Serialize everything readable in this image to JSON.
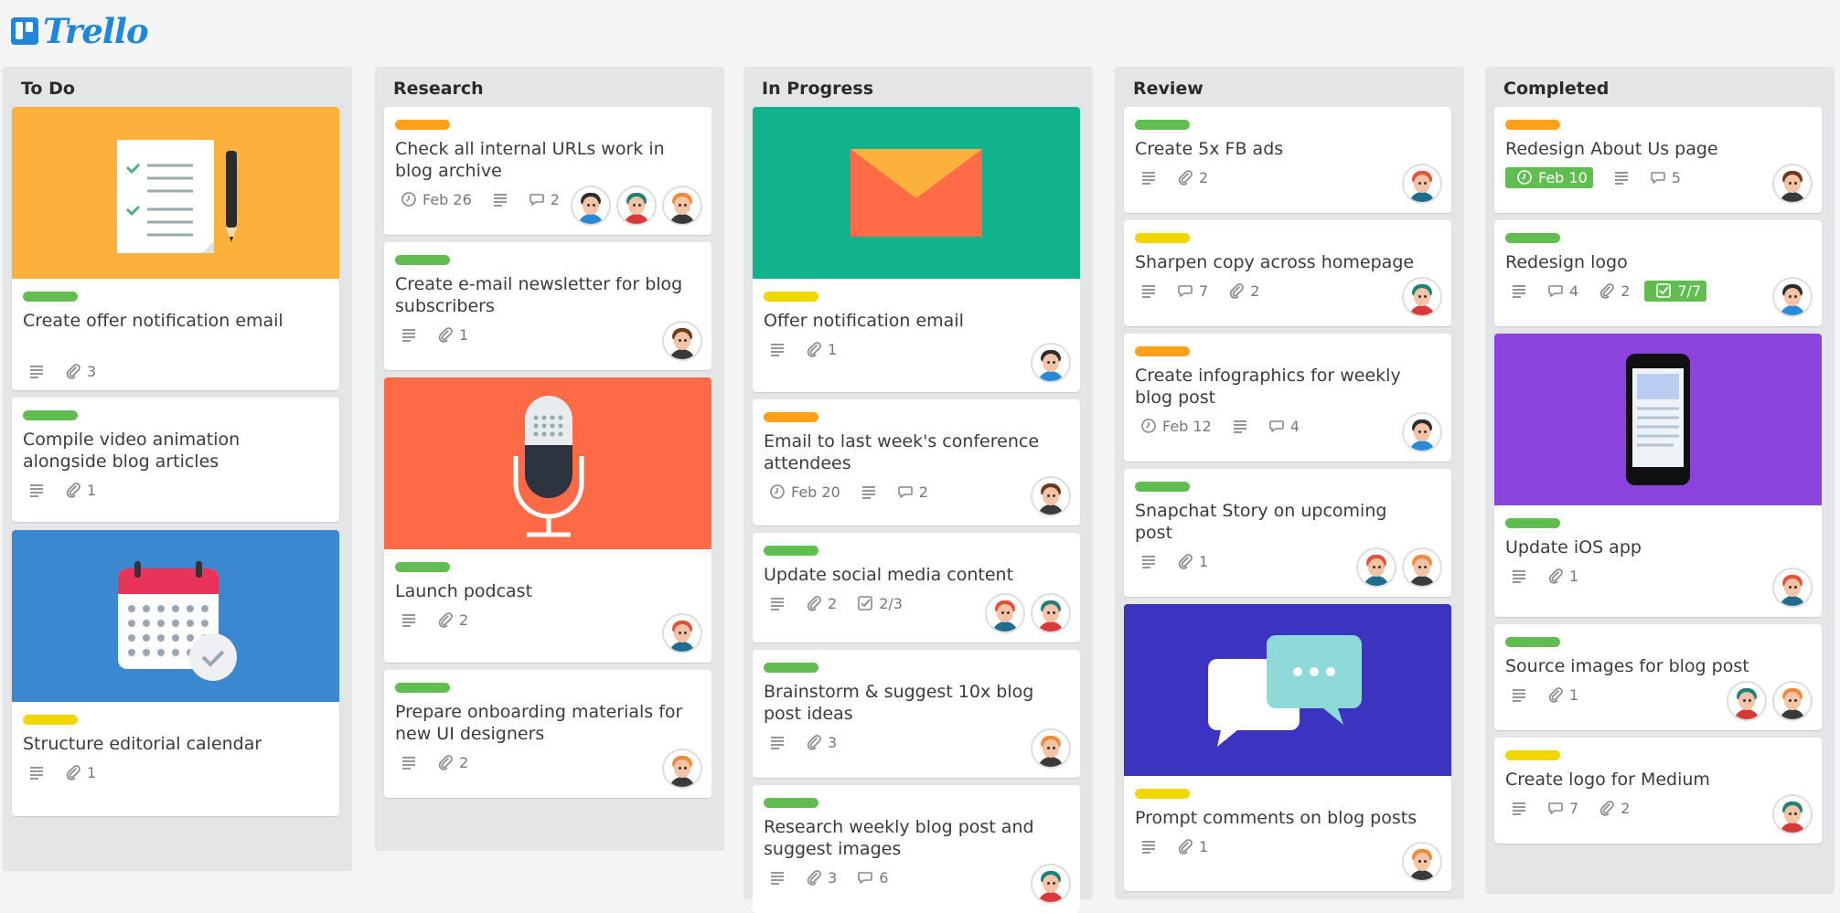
{
  "app": {
    "name": "Trello"
  },
  "colors": {
    "green": "#61bd4f",
    "yellow": "#f2d600",
    "orange": "#ff9f1a",
    "cover_yellow": "#fbb13c",
    "cover_blue": "#3b87d0",
    "cover_orange": "#fe6a46",
    "cover_teal": "#10b38b",
    "cover_indigo": "#3a34c1",
    "cover_purple": "#8c44df"
  },
  "lists": [
    {
      "title": "To Do",
      "cards": [
        {
          "cover": "checklist-doc",
          "label": "green",
          "title": "Create offer notification email",
          "badges": [
            {
              "icon": "description-icon"
            },
            {
              "icon": "attachment-icon",
              "value": "3"
            }
          ],
          "members": []
        },
        {
          "cover": null,
          "label": "green",
          "title": "Compile video animation alongside blog articles",
          "badges": [
            {
              "icon": "description-icon"
            },
            {
              "icon": "attachment-icon",
              "value": "1"
            }
          ],
          "members": []
        },
        {
          "cover": "calendar",
          "label": "yellow",
          "title": "Structure editorial calendar",
          "badges": [
            {
              "icon": "description-icon"
            },
            {
              "icon": "attachment-icon",
              "value": "1"
            }
          ],
          "members": []
        }
      ]
    },
    {
      "title": "Research",
      "cards": [
        {
          "cover": null,
          "label": "orange",
          "title": "Check all internal URLs work in blog archive",
          "badges": [
            {
              "icon": "clock-icon",
              "value": "Feb 26"
            },
            {
              "icon": "description-icon"
            },
            {
              "icon": "comment-icon",
              "value": "2"
            }
          ],
          "members": [
            "dark-hair",
            "teal-hair",
            "ginger"
          ]
        },
        {
          "cover": null,
          "label": "green",
          "title": "Create e-mail newsletter for blog subscribers",
          "badges": [
            {
              "icon": "description-icon"
            },
            {
              "icon": "attachment-icon",
              "value": "1"
            }
          ],
          "members": [
            "brown-glasses"
          ]
        },
        {
          "cover": "microphone",
          "label": "green",
          "title": "Launch podcast",
          "badges": [
            {
              "icon": "description-icon"
            },
            {
              "icon": "attachment-icon",
              "value": "2"
            }
          ],
          "members": [
            "red-hair"
          ]
        },
        {
          "cover": null,
          "label": "green",
          "title": "Prepare onboarding materials for new UI designers",
          "badges": [
            {
              "icon": "description-icon"
            },
            {
              "icon": "attachment-icon",
              "value": "2"
            }
          ],
          "members": [
            "ginger"
          ]
        }
      ]
    },
    {
      "title": "In Progress",
      "cards": [
        {
          "cover": "envelope",
          "label": "yellow",
          "title": "Offer notification email",
          "badges": [
            {
              "icon": "description-icon"
            },
            {
              "icon": "attachment-icon",
              "value": "1"
            }
          ],
          "members": [
            "dark-hair"
          ]
        },
        {
          "cover": null,
          "label": "orange",
          "title": "Email to last week's conference attendees",
          "badges": [
            {
              "icon": "clock-icon",
              "value": "Feb 20"
            },
            {
              "icon": "description-icon"
            },
            {
              "icon": "comment-icon",
              "value": "2"
            }
          ],
          "members": [
            "brown-glasses"
          ]
        },
        {
          "cover": null,
          "label": "green",
          "title": "Update social media content",
          "badges": [
            {
              "icon": "description-icon"
            },
            {
              "icon": "attachment-icon",
              "value": "2"
            },
            {
              "icon": "checklist-icon",
              "value": "2/3"
            }
          ],
          "members": [
            "red-hair",
            "teal-hair"
          ]
        },
        {
          "cover": null,
          "label": "green",
          "title": "Brainstorm & suggest 10x blog post ideas",
          "badges": [
            {
              "icon": "description-icon"
            },
            {
              "icon": "attachment-icon",
              "value": "3"
            }
          ],
          "members": [
            "ginger"
          ]
        },
        {
          "cover": null,
          "label": "green",
          "title": "Research weekly blog post and suggest images",
          "badges": [
            {
              "icon": "description-icon"
            },
            {
              "icon": "attachment-icon",
              "value": "3"
            },
            {
              "icon": "comment-icon",
              "value": "6"
            }
          ],
          "members": [
            "teal-hair"
          ]
        }
      ]
    },
    {
      "title": "Review",
      "cards": [
        {
          "cover": null,
          "label": "green",
          "title": "Create 5x FB ads",
          "badges": [
            {
              "icon": "description-icon"
            },
            {
              "icon": "attachment-icon",
              "value": "2"
            }
          ],
          "members": [
            "red-hair"
          ]
        },
        {
          "cover": null,
          "label": "yellow",
          "title": "Sharpen copy across homepage",
          "badges": [
            {
              "icon": "description-icon"
            },
            {
              "icon": "comment-icon",
              "value": "7"
            },
            {
              "icon": "attachment-icon",
              "value": "2"
            }
          ],
          "members": [
            "teal-hair"
          ]
        },
        {
          "cover": null,
          "label": "orange",
          "title": "Create infographics for weekly blog post",
          "badges": [
            {
              "icon": "clock-icon",
              "value": "Feb 12"
            },
            {
              "icon": "description-icon"
            },
            {
              "icon": "comment-icon",
              "value": "4"
            }
          ],
          "members": [
            "dark-hair"
          ]
        },
        {
          "cover": null,
          "label": "green",
          "title": "Snapchat Story on upcoming post",
          "badges": [
            {
              "icon": "description-icon"
            },
            {
              "icon": "attachment-icon",
              "value": "1"
            }
          ],
          "members": [
            "red-hair",
            "ginger"
          ]
        },
        {
          "cover": "chat-bubbles",
          "label": "yellow",
          "title": "Prompt comments on blog posts",
          "badges": [
            {
              "icon": "description-icon"
            },
            {
              "icon": "attachment-icon",
              "value": "1"
            }
          ],
          "members": [
            "ginger"
          ]
        }
      ]
    },
    {
      "title": "Completed",
      "cards": [
        {
          "cover": null,
          "label": "orange",
          "title": "Redesign About Us page",
          "badges": [
            {
              "icon": "clock-icon",
              "value": "Feb 10",
              "done": true
            },
            {
              "icon": "description-icon"
            },
            {
              "icon": "comment-icon",
              "value": "5"
            }
          ],
          "members": [
            "brown-glasses"
          ]
        },
        {
          "cover": null,
          "label": "green",
          "title": "Redesign logo",
          "badges": [
            {
              "icon": "description-icon"
            },
            {
              "icon": "comment-icon",
              "value": "4"
            },
            {
              "icon": "attachment-icon",
              "value": "2"
            },
            {
              "icon": "checklist-icon",
              "value": "7/7",
              "done": true
            }
          ],
          "members": [
            "dark-hair"
          ]
        },
        {
          "cover": "phone",
          "label": "green",
          "title": "Update iOS app",
          "badges": [
            {
              "icon": "description-icon"
            },
            {
              "icon": "attachment-icon",
              "value": "1"
            }
          ],
          "members": [
            "red-hair"
          ]
        },
        {
          "cover": null,
          "label": "green",
          "title": "Source images for blog post",
          "badges": [
            {
              "icon": "description-icon"
            },
            {
              "icon": "attachment-icon",
              "value": "1"
            }
          ],
          "members": [
            "teal-hair",
            "ginger"
          ]
        },
        {
          "cover": null,
          "label": "yellow",
          "title": "Create logo for Medium",
          "badges": [
            {
              "icon": "description-icon"
            },
            {
              "icon": "comment-icon",
              "value": "7"
            },
            {
              "icon": "attachment-icon",
              "value": "2"
            }
          ],
          "members": [
            "teal-hair"
          ]
        }
      ]
    }
  ]
}
